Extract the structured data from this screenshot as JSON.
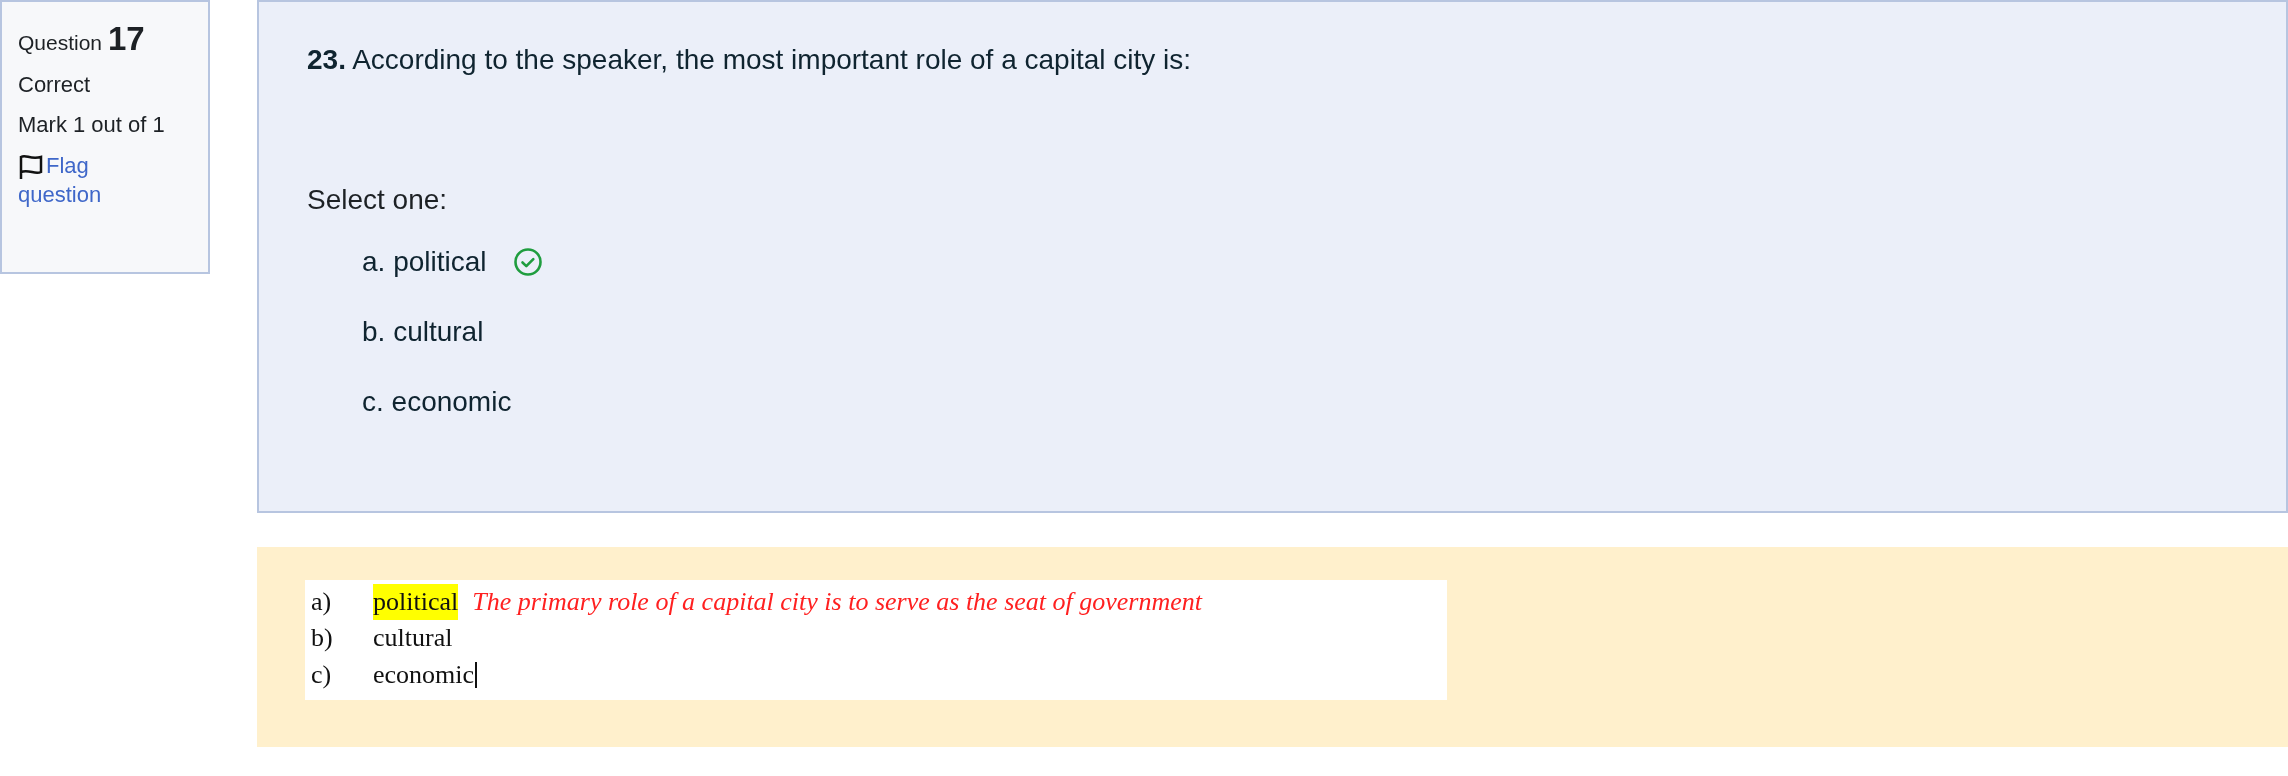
{
  "question_info": {
    "label": "Question",
    "number": "17",
    "state": "Correct",
    "mark": "Mark 1 out of 1",
    "flag_link": "Flag question"
  },
  "question": {
    "number": "23.",
    "text": "According to the speaker, the most important role of a capital city is:",
    "prompt": "Select one:",
    "options": [
      {
        "label": "a. political",
        "correct": true
      },
      {
        "label": "b. cultural",
        "correct": false
      },
      {
        "label": "c. economic",
        "correct": false
      }
    ]
  },
  "feedback": {
    "lines": [
      {
        "marker": "a)",
        "answer": "political",
        "highlighted": true,
        "note": "The primary role of a capital city is to serve as the seat of government",
        "cursor": false
      },
      {
        "marker": "b)",
        "answer": "cultural",
        "highlighted": false,
        "cursor": false
      },
      {
        "marker": "c)",
        "answer": "economic",
        "highlighted": false,
        "cursor": true
      }
    ]
  }
}
